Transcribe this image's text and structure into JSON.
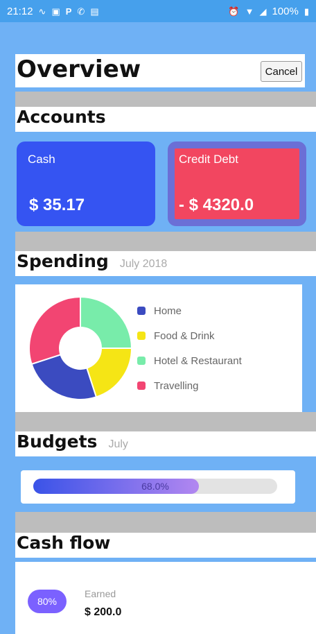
{
  "status_bar": {
    "time": "21:12",
    "battery": "100%",
    "left_icons": [
      "activity-icon",
      "image-icon",
      "parking-icon",
      "phone-icon",
      "card-icon"
    ],
    "right_icons": [
      "alarm-icon",
      "wifi-icon",
      "signal-icon",
      "battery-icon"
    ]
  },
  "header": {
    "title": "Overview",
    "cancel_label": "Cancel"
  },
  "accounts": {
    "title": "Accounts",
    "cards": [
      {
        "label": "Cash",
        "amount": "$ 35.17",
        "color": "#3554f2"
      },
      {
        "label": "Credit Debt",
        "amount": "- $ 4320.0",
        "color": "#f24660",
        "border": "#6b6fd6"
      }
    ]
  },
  "spending": {
    "title": "Spending",
    "subtitle": "July 2018",
    "legend": [
      {
        "label": "Home",
        "color": "#3b4bc0"
      },
      {
        "label": "Food & Drink",
        "color": "#f5e515"
      },
      {
        "label": "Hotel & Restaurant",
        "color": "#78ecaa"
      },
      {
        "label": "Travelling",
        "color": "#f24572"
      }
    ]
  },
  "budgets": {
    "title": "Budgets",
    "subtitle": "July",
    "percent_label": "68.0%",
    "fill_fraction": 0.68
  },
  "cash_flow": {
    "title": "Cash flow",
    "badge": "80%",
    "earned_label": "Earned",
    "earned_amount": "$ 200.0"
  },
  "chart_data": {
    "type": "pie",
    "title": "",
    "labels": [
      "Home",
      "Food & Drink",
      "Hotel & Restaurant",
      "Travelling"
    ],
    "values": [
      25,
      20,
      25,
      30
    ],
    "colors": [
      "#3b4bc0",
      "#f5e515",
      "#78ecaa",
      "#f24572"
    ]
  }
}
